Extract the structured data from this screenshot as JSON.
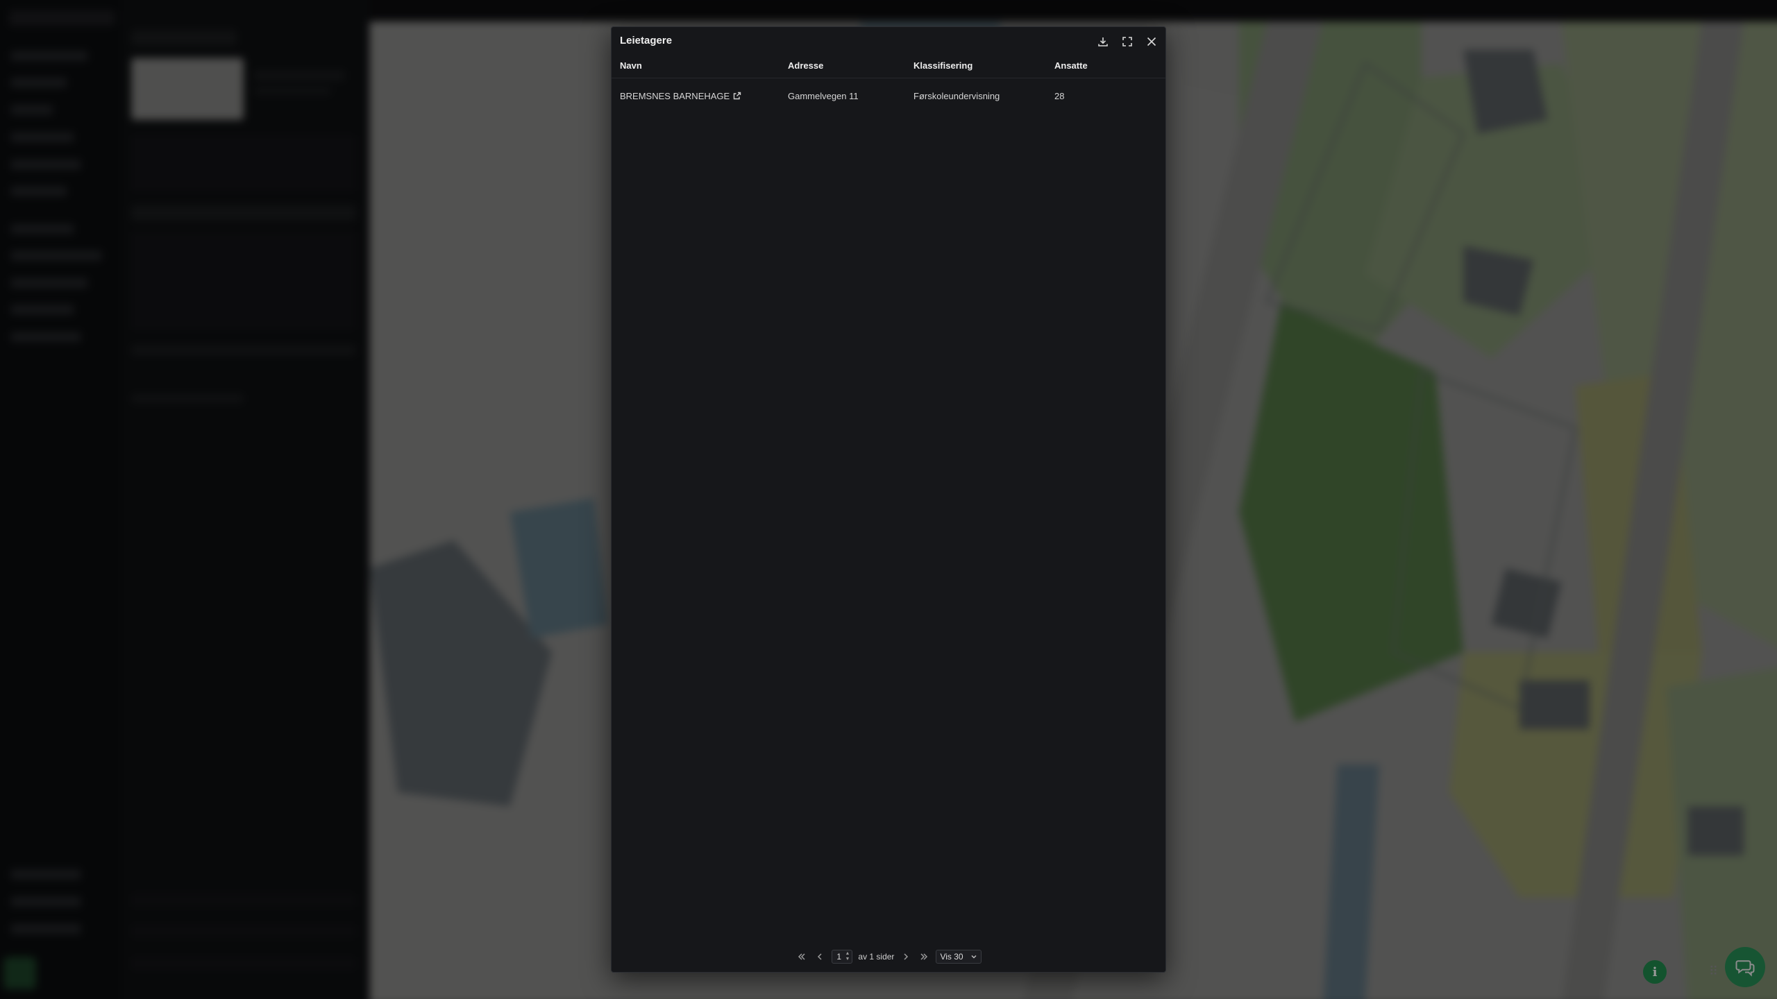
{
  "modal": {
    "title": "Leietagere",
    "buttons": {
      "download": "download-icon",
      "expand": "expand-icon",
      "close": "close-icon"
    }
  },
  "table": {
    "columns": [
      "Navn",
      "Adresse",
      "Klassifisering",
      "Ansatte"
    ],
    "rows": [
      {
        "name": "BREMSNES BARNEHAGE",
        "address": "Gammelvegen 11",
        "classification": "Førskoleundervisning",
        "employees": "28"
      }
    ]
  },
  "pagination": {
    "current_page": "1",
    "of_pages_text": "av 1 sider",
    "per_page": "Vis 30"
  },
  "colors": {
    "modal_bg": "#16171a",
    "chat_button": "#2a9a5c"
  }
}
